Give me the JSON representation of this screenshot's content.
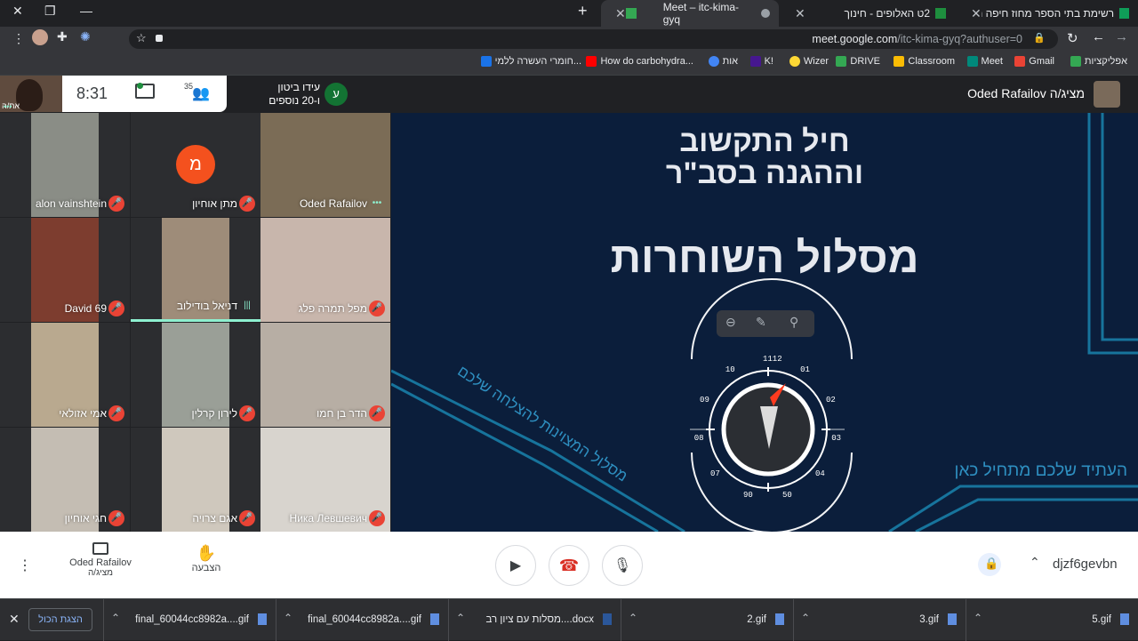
{
  "browser": {
    "tabs": [
      {
        "label": "רשימת בתי הספר מחוז חיפה תח"
      },
      {
        "label": "2ט האלופים - חינוך"
      },
      {
        "label": "Meet – itc-kima-gyq",
        "active": true
      }
    ],
    "new_tab": "+",
    "url_main": "meet.google.com",
    "url_rest": "/itc-kima-gyq?authuser=0",
    "bookmarks": [
      {
        "label": "אפליקציות",
        "color": "#5f6368"
      },
      {
        "label": "Gmail",
        "color": "#ea4335"
      },
      {
        "label": "Meet",
        "color": "#00897b"
      },
      {
        "label": "Classroom",
        "color": "#fbbc04"
      },
      {
        "label": "DRIVE",
        "color": "#34a853"
      },
      {
        "label": "Wizer",
        "color": "#fdd835"
      },
      {
        "label": "K!",
        "color": "#46178f"
      },
      {
        "label": "אות",
        "color": "#4285f4"
      },
      {
        "label": "How do carbohydra...",
        "color": "#ff0000"
      },
      {
        "label": "חומרי העשרה ללמי...",
        "color": "#1a73e8"
      }
    ]
  },
  "meet": {
    "time": "8:31",
    "participants_count": "35",
    "self_label": "את/ה",
    "joining": {
      "avatar_letter": "ע",
      "line1": "עידו ביטון",
      "line2": "ו-20 נוספים"
    },
    "presenter": {
      "name": "Oded Rafailov",
      "suffix": "מציג/ה"
    },
    "tiles": [
      {
        "name": "Oded Rafailov",
        "color": "#7b6c56"
      },
      {
        "name": "מתן אוחיון",
        "avatar": "מ",
        "color": "#202124"
      },
      {
        "name": "alon vainshtein",
        "color": "#8a8d86"
      },
      {
        "name": "מפל תמרה פלג",
        "color": "#c8b6ac"
      },
      {
        "name": "דניאל בודילוב",
        "color": "#9e8c79"
      },
      {
        "name": "David 69",
        "color": "#7d3d2f"
      },
      {
        "name": "הדר בן חמו",
        "color": "#b7aea4"
      },
      {
        "name": "לירון קרלין",
        "color": "#9a9f97"
      },
      {
        "name": "אמי אזולאי",
        "color": "#b9a98f"
      },
      {
        "name": "Ника Левшевич",
        "color": "#d8d4ce"
      },
      {
        "name": "אגם צרויה",
        "color": "#cfc8bd"
      },
      {
        "name": "חגי אוחיון",
        "color": "#c4bdb3"
      }
    ],
    "slide": {
      "title_line1": "חיל התקשוב",
      "title_line2": "וההגנה בסב\"ר",
      "heading": "מסלול השוחרות",
      "diagonal_text": "מסלול המצוינות להצלחה שלכם",
      "tagline": "העתיד שלכם מתחיל כאן",
      "dial_numbers": [
        "1112",
        "01",
        "02",
        "03",
        "04",
        "50",
        "90",
        "07",
        "08",
        "09",
        "10"
      ]
    }
  },
  "controls": {
    "presenting_name": "Oded Rafailov",
    "presenting_suffix": "מציג/ה",
    "raise_hand": "הצבעה",
    "meeting_code": "djzf6gevbn"
  },
  "downloads": {
    "show_all": "הצגת הכול",
    "items": [
      "5.gif",
      "3.gif",
      "2.gif",
      "מסלות עם ציון רב....docx",
      "final_60044cc8982a....gif",
      "final_60044cc8982a....gif"
    ]
  }
}
